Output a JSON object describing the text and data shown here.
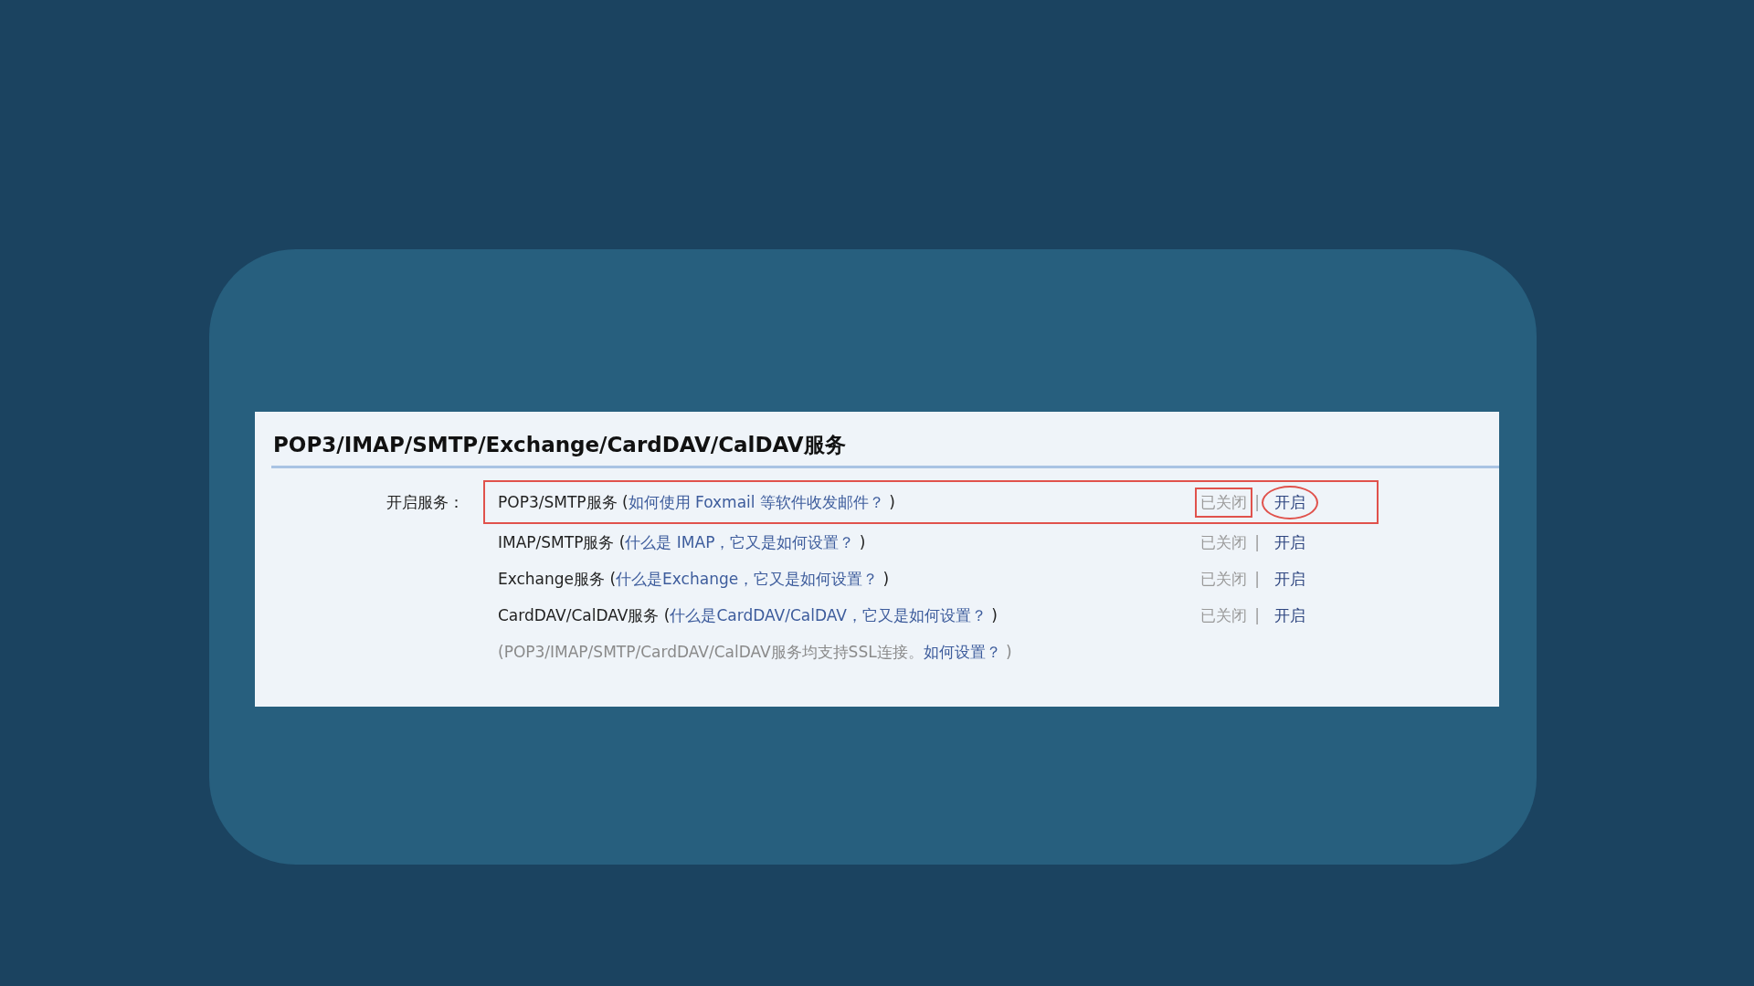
{
  "section": {
    "title": "POP3/IMAP/SMTP/Exchange/CardDAV/CalDAV服务",
    "label": "开启服务：",
    "services": [
      {
        "prefix": "POP3/SMTP服务 (",
        "link": "如何使用 Foxmail 等软件收发邮件？",
        "suffix": " )",
        "status": "已关闭",
        "separator": "|",
        "action": "开启",
        "highlighted": true
      },
      {
        "prefix": "IMAP/SMTP服务 (",
        "link": "什么是 IMAP，它又是如何设置？",
        "suffix": " )",
        "status": "已关闭",
        "separator": "|",
        "action": "开启",
        "highlighted": false
      },
      {
        "prefix": "Exchange服务 (",
        "link": "什么是Exchange，它又是如何设置？",
        "suffix": " )",
        "status": "已关闭",
        "separator": "|",
        "action": "开启",
        "highlighted": false
      },
      {
        "prefix": "CardDAV/CalDAV服务 (",
        "link": "什么是CardDAV/CalDAV，它又是如何设置？",
        "suffix": " )",
        "status": "已关闭",
        "separator": "|",
        "action": "开启",
        "highlighted": false
      }
    ],
    "footnote": {
      "text": "(POP3/IMAP/SMTP/CardDAV/CalDAV服务均支持SSL连接。",
      "link": "如何设置？",
      "suffix": " )"
    }
  }
}
